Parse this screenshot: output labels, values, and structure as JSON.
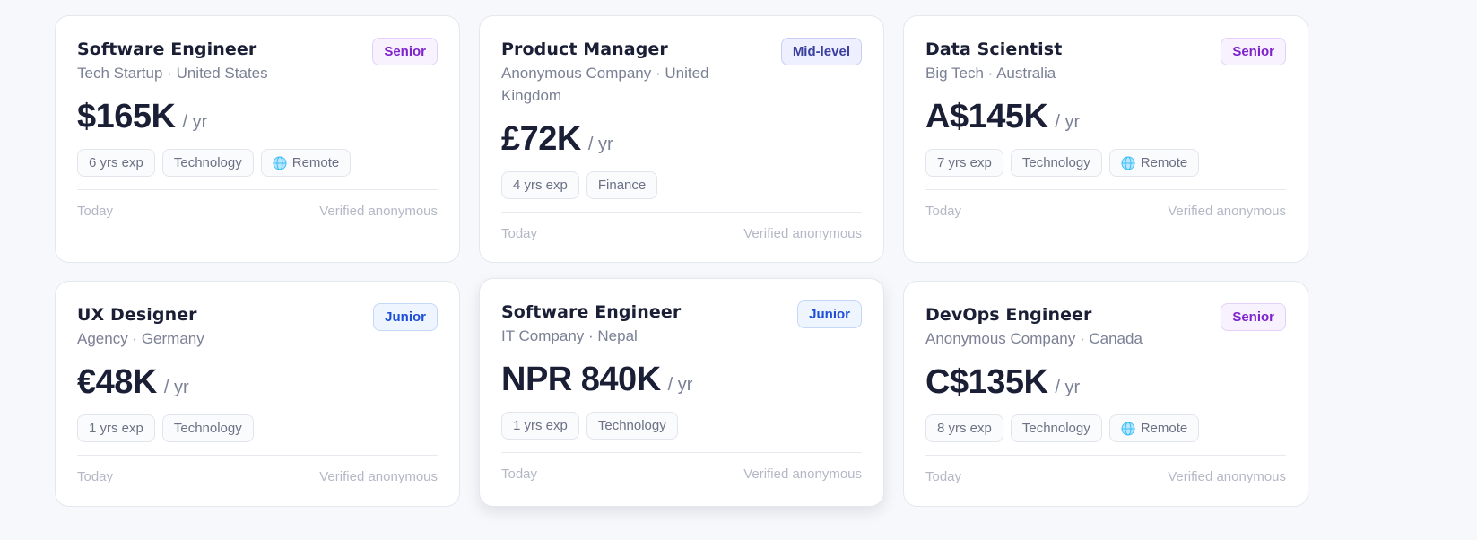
{
  "per_label": "/ yr",
  "footer": {
    "date": "Today",
    "verified": "Verified anonymous"
  },
  "cards": [
    {
      "title": "Software Engineer",
      "company": "Tech Startup",
      "location": "United States",
      "level": "Senior",
      "salary": "$165K",
      "tags": [
        "6 yrs exp",
        "Technology",
        "Remote"
      ]
    },
    {
      "title": "Product Manager",
      "company": "Anonymous Company",
      "location": "United Kingdom",
      "level": "Mid-level",
      "salary": "£72K",
      "tags": [
        "4 yrs exp",
        "Finance"
      ]
    },
    {
      "title": "Data Scientist",
      "company": "Big Tech",
      "location": "Australia",
      "level": "Senior",
      "salary": "A$145K",
      "tags": [
        "7 yrs exp",
        "Technology",
        "Remote"
      ]
    },
    {
      "title": "UX Designer",
      "company": "Agency",
      "location": "Germany",
      "level": "Junior",
      "salary": "€48K",
      "tags": [
        "1 yrs exp",
        "Technology"
      ]
    },
    {
      "title": "Software Engineer",
      "company": "IT Company",
      "location": "Nepal",
      "level": "Junior",
      "salary": "NPR 840K",
      "tags": [
        "1 yrs exp",
        "Technology"
      ]
    },
    {
      "title": "DevOps Engineer",
      "company": "Anonymous Company",
      "location": "Canada",
      "level": "Senior",
      "salary": "C$135K",
      "tags": [
        "8 yrs exp",
        "Technology",
        "Remote"
      ]
    }
  ],
  "colors": {
    "senior_badge": "#7e22ce",
    "mid_badge": "#3b3f9e",
    "junior_badge": "#1d4ed8",
    "remote_icon": "#38bdf8"
  },
  "icons": {
    "remote": "globe-icon"
  }
}
